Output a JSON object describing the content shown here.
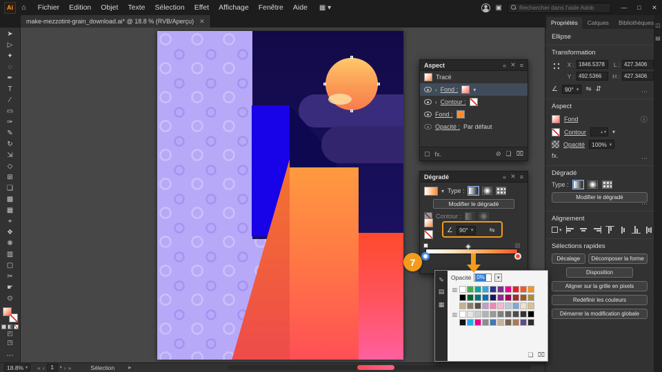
{
  "colors": {
    "accent_orange": "#F29B1D",
    "selection_blue": "#2F7ED8",
    "lavender": "#B7A9F8",
    "navy": "#150D52",
    "cloud_purple": "#3A2C7C",
    "bright_blue": "#1803E8",
    "building_orange": "#FF8A3C",
    "building_red": "#FF5452",
    "strip_pink": "#FF5E9E"
  },
  "titlebar": {
    "menus": [
      "Fichier",
      "Edition",
      "Objet",
      "Texte",
      "Sélection",
      "Effet",
      "Affichage",
      "Fenêtre",
      "Aide"
    ],
    "search_placeholder": "Rechercher dans l'aide Adob"
  },
  "tab": {
    "title": "make-mezzotint-grain_download.ai* @ 18.8 % (RVB/Aperçu)"
  },
  "toolbar": {
    "tools": [
      {
        "name": "selection-tool",
        "glyph": "➤"
      },
      {
        "name": "direct-selection-tool",
        "glyph": "▷"
      },
      {
        "name": "magic-wand-tool",
        "glyph": "✦"
      },
      {
        "name": "lasso-tool",
        "glyph": "◌"
      },
      {
        "name": "pen-tool",
        "glyph": "✒"
      },
      {
        "name": "type-tool",
        "glyph": "T"
      },
      {
        "name": "line-segment-tool",
        "glyph": "∕"
      },
      {
        "name": "rectangle-tool",
        "glyph": "▭"
      },
      {
        "name": "paintbrush-tool",
        "glyph": "✑"
      },
      {
        "name": "pencil-tool",
        "glyph": "✎"
      },
      {
        "name": "rotate-tool",
        "glyph": "↻"
      },
      {
        "name": "scale-tool",
        "glyph": "⇲"
      },
      {
        "name": "width-tool",
        "glyph": "◇"
      },
      {
        "name": "free-transform-tool",
        "glyph": "⊞"
      },
      {
        "name": "shape-builder-tool",
        "glyph": "❑"
      },
      {
        "name": "gradient-tool",
        "glyph": "▩"
      },
      {
        "name": "mesh-tool",
        "glyph": "▦"
      },
      {
        "name": "eyedropper-tool",
        "glyph": "⌖"
      },
      {
        "name": "blend-tool",
        "glyph": "❖"
      },
      {
        "name": "symbol-sprayer-tool",
        "glyph": "❋"
      },
      {
        "name": "graph-tool",
        "glyph": "▥"
      },
      {
        "name": "artboard-tool",
        "glyph": "▢"
      },
      {
        "name": "slice-tool",
        "glyph": "✂"
      },
      {
        "name": "hand-tool",
        "glyph": "☛"
      },
      {
        "name": "zoom-tool",
        "glyph": "⊙"
      }
    ]
  },
  "aspect_panel": {
    "title": "Aspect",
    "row_trace": "Tracé",
    "row_fill": "Fond :",
    "row_stroke": "Contour :",
    "row_fill2": "Fond :",
    "row_opacity": "Opacité :",
    "opacity_value": "Par défaut",
    "fx": "fx."
  },
  "gradient_panel": {
    "title": "Dégradé",
    "type_label": "Type :",
    "edit_button": "Modifier le dégradé",
    "stroke_label": "Contour :",
    "angle": "90°"
  },
  "opacity_popup": {
    "label": "Opacité",
    "value": "0%",
    "groups": [
      {
        "rows": [
          [
            "#ffffff",
            "#41ad49",
            "#00a99d",
            "#29abe2",
            "#2e3192",
            "#7b2e8e",
            "#ec008c",
            "#ed1c24",
            "#f15a24",
            "#f7941d"
          ],
          [
            "#000000",
            "#006838",
            "#00747a",
            "#0071bc",
            "#1b1464",
            "#93278f",
            "#9e005d",
            "#a72b2a",
            "#a05a21",
            "#aa8d39"
          ],
          [
            "#c8b18b",
            "#8a7d6c",
            "#59514a",
            "#c49bc9",
            "#ef86b5",
            "#f8b8d2",
            "#bdccd4",
            "#7da7d9",
            "#efe3c5",
            "#d6c291"
          ]
        ]
      },
      {
        "rows": [
          [
            "#ffffff",
            "#e6e6e6",
            "#cccccc",
            "#b3b3b3",
            "#999999",
            "#808080",
            "#666666",
            "#4d4d4d",
            "#333333",
            "#000000"
          ],
          [
            "#101010",
            "#29abe2",
            "#ec008c",
            "#8c8c8c",
            "#4575b4",
            "#c7b299",
            "#736357",
            "#a67c52",
            "#5f4a8b",
            "#2d2d2d"
          ]
        ]
      }
    ]
  },
  "annotation": {
    "step": "7"
  },
  "properties_panel": {
    "tabs": [
      "Propriétés",
      "Calques",
      "Bibliothèques"
    ],
    "object_type": "Ellipse",
    "transform": {
      "title": "Transformation",
      "x_label": "X :",
      "x": "1846.5378",
      "y_label": "Y :",
      "y": "492.5366",
      "w_label": "L :",
      "w": "427.3406",
      "h_label": "H :",
      "h": "427.3406",
      "angle": "90°"
    },
    "aspect": {
      "title": "Aspect",
      "fill_label": "Fond",
      "stroke_label": "Contour",
      "opacity_label": "Opacité",
      "opacity_value": "100%",
      "fx": "fx."
    },
    "gradient": {
      "title": "Dégradé",
      "type_label": "Type :",
      "edit_button": "Modifier le dégradé"
    },
    "align": {
      "title": "Alignement",
      "icons": [
        "align-left",
        "align-center-h",
        "align-right",
        "align-top",
        "align-middle",
        "align-bottom",
        "distribute-v",
        "distribute-h",
        "align-more"
      ]
    },
    "quick": {
      "title": "Sélections rapides",
      "buttons": [
        "Décalage",
        "Décomposer la forme",
        "Disposition",
        "Aligner sur la grille en pixels",
        "Redéfinir les couleurs",
        "Démarrer la modification globale"
      ]
    }
  },
  "statusbar": {
    "zoom": "18.8%",
    "artboard": "1",
    "tool": "Sélection"
  }
}
